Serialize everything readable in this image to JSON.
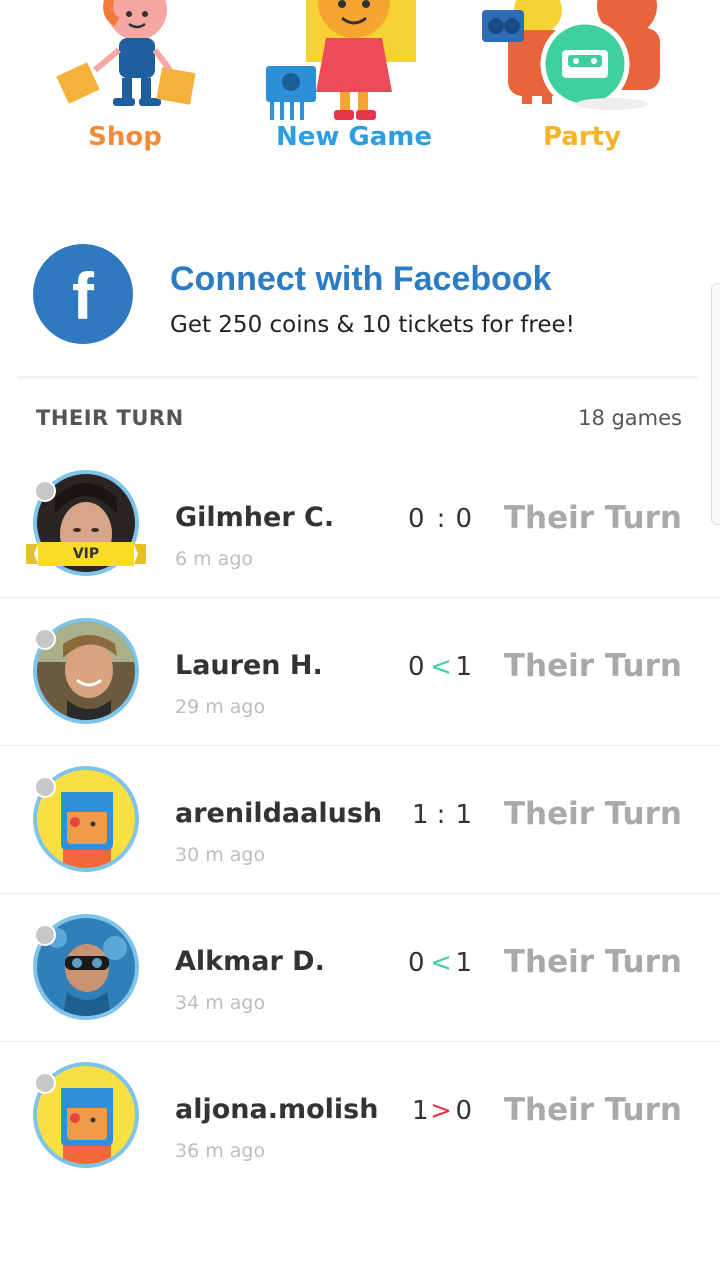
{
  "menu": {
    "shop_label": "Shop",
    "new_game_label": "New Game",
    "party_label": "Party",
    "colors": {
      "shop": "#f28a3c",
      "new_game": "#2e9ee0",
      "party": "#f4b42a"
    }
  },
  "facebook": {
    "icon_glyph": "f",
    "title": "Connect with Facebook",
    "subtitle": "Get 250 coins & 10 tickets for free!"
  },
  "section": {
    "title": "THEIR TURN",
    "count": "18 games"
  },
  "games": [
    {
      "name": "Gilmher C.",
      "ago": "6 m ago",
      "score_left": "0",
      "separator": ":",
      "score_right": "0",
      "status": "Their Turn",
      "vip": "VIP",
      "avatar": "photo-avatar"
    },
    {
      "name": "Lauren H.",
      "ago": "29 m ago",
      "score_left": "0",
      "separator": "<",
      "score_right": "1",
      "status": "Their Turn",
      "avatar": "photo-avatar"
    },
    {
      "name": "arenildaalush",
      "ago": "30 m ago",
      "score_left": "1",
      "separator": ":",
      "score_right": "1",
      "status": "Their Turn",
      "avatar": "default-avatar"
    },
    {
      "name": "Alkmar D.",
      "ago": "34 m ago",
      "score_left": "0",
      "separator": "<",
      "score_right": "1",
      "status": "Their Turn",
      "avatar": "photo-avatar"
    },
    {
      "name": "aljona.molish",
      "ago": "36 m ago",
      "score_left": "1",
      "separator": ">",
      "score_right": "0",
      "status": "Their Turn",
      "avatar": "default-avatar"
    }
  ]
}
